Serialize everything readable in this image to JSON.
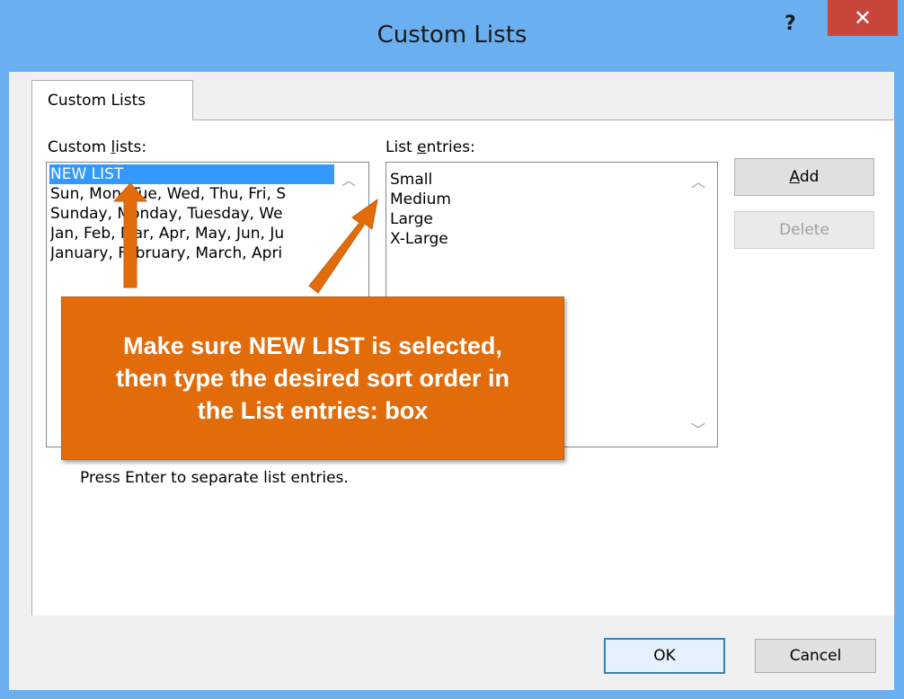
{
  "window": {
    "title": "Custom Lists",
    "help_label": "?",
    "close_label": "✕"
  },
  "tabs": [
    {
      "label": "Custom Lists"
    }
  ],
  "custom_lists": {
    "label_before": "Custom ",
    "label_underlined": "l",
    "label_after": "ists:",
    "items": [
      {
        "text": "NEW LIST",
        "selected": true
      },
      {
        "text": "Sun, Mon, Tue, Wed, Thu, Fri, S"
      },
      {
        "text": "Sunday, Monday, Tuesday, We"
      },
      {
        "text": "Jan, Feb, Mar, Apr, May, Jun, Ju"
      },
      {
        "text": "January, February, March, Apri"
      }
    ]
  },
  "list_entries": {
    "label_before": "List ",
    "label_underlined": "e",
    "label_after": "ntries:",
    "items": [
      "Small",
      "Medium",
      "Large",
      "X-Large"
    ]
  },
  "buttons": {
    "add_underlined": "A",
    "add_rest": "dd",
    "delete": "Delete",
    "ok": "OK",
    "cancel": "Cancel"
  },
  "hint": "Press Enter to separate list entries.",
  "callout": {
    "text": "Make sure NEW LIST is selected, then type the desired sort order in the List entries: box"
  },
  "colors": {
    "title_bar": "#6aaff0",
    "close_button": "#c9463d",
    "selection": "#3399ff",
    "callout": "#e36c0a"
  }
}
